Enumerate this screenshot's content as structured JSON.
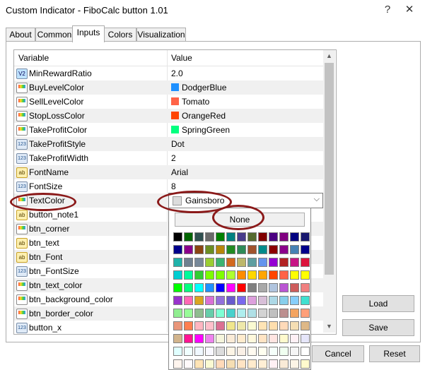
{
  "window": {
    "title": "Custom Indicator - FiboCalc button 1.01",
    "help_glyph": "?",
    "close_glyph": "✕"
  },
  "tabs": [
    {
      "label": "About"
    },
    {
      "label": "Common"
    },
    {
      "label": "Inputs",
      "active": true
    },
    {
      "label": "Colors"
    },
    {
      "label": "Visualization"
    }
  ],
  "grid": {
    "header": {
      "variable": "Variable",
      "value": "Value"
    },
    "rows": [
      {
        "name": "MinRewardRatio",
        "icon": "v2-icon",
        "value": "2.0"
      },
      {
        "name": "BuyLevelColor",
        "icon": "color-icon",
        "value": "DodgerBlue",
        "color": "#1e90ff"
      },
      {
        "name": "SellLevelColor",
        "icon": "color-icon",
        "value": "Tomato",
        "color": "#ff6347"
      },
      {
        "name": "StopLossColor",
        "icon": "color-icon",
        "value": "OrangeRed",
        "color": "#ff4500"
      },
      {
        "name": "TakeProfitColor",
        "icon": "color-icon",
        "value": "SpringGreen",
        "color": "#00ff7f"
      },
      {
        "name": "TakeProfitStyle",
        "icon": "int-icon",
        "value": "Dot"
      },
      {
        "name": "TakeProfitWidth",
        "icon": "int-icon",
        "value": "2"
      },
      {
        "name": "FontName",
        "icon": "string-icon",
        "value": "Arial"
      },
      {
        "name": "FontSize",
        "icon": "int-icon",
        "value": "8"
      },
      {
        "name": "TextColor",
        "icon": "color-icon",
        "value": ""
      },
      {
        "name": "button_note1",
        "icon": "string-icon",
        "value": ""
      },
      {
        "name": "btn_corner",
        "icon": "color-icon",
        "value": ""
      },
      {
        "name": "btn_text",
        "icon": "string-icon",
        "value": ""
      },
      {
        "name": "btn_Font",
        "icon": "string-icon",
        "value": ""
      },
      {
        "name": "btn_FontSize",
        "icon": "int-icon",
        "value": ""
      },
      {
        "name": "btn_text_color",
        "icon": "color-icon",
        "value": ""
      },
      {
        "name": "btn_background_color",
        "icon": "color-icon",
        "value": ""
      },
      {
        "name": "btn_border_color",
        "icon": "color-icon",
        "value": ""
      },
      {
        "name": "button_x",
        "icon": "int-icon",
        "value": ""
      }
    ]
  },
  "dropdown": {
    "value": "Gainsboro",
    "swatch": "#dcdcdc"
  },
  "popup": {
    "none_label": "None"
  },
  "palette": [
    [
      "#000000",
      "#006400",
      "#2f4f4f",
      "#696969",
      "#008000",
      "#008080",
      "#483d8b",
      "#556b2f",
      "#800000",
      "#4b0082",
      "#800080",
      "#000080",
      "#191970"
    ],
    [
      "#00008b",
      "#8b008b",
      "#8b4513",
      "#6b8e23",
      "#b8860b",
      "#228b22",
      "#2e8b57",
      "#a0522d",
      "#008b8b",
      "#8b0000",
      "#8b008b",
      "#4682b4",
      "#00008b"
    ],
    [
      "#20b2aa",
      "#708090",
      "#778899",
      "#9acd32",
      "#3cb371",
      "#d2691e",
      "#bdb76b",
      "#5f9ea0",
      "#6495ed",
      "#9400d3",
      "#b22222",
      "#c71585",
      "#dc143c"
    ],
    [
      "#00ced1",
      "#00fa9a",
      "#32cd32",
      "#7cfc00",
      "#7fff00",
      "#adff2f",
      "#ff8c00",
      "#ffd700",
      "#ffa500",
      "#ff4500",
      "#ff6347",
      "#ffff00",
      "#ffff00"
    ],
    [
      "#00ff00",
      "#00ff7f",
      "#00ffff",
      "#1e90ff",
      "#0000ff",
      "#ff00ff",
      "#ff0000",
      "#808080",
      "#a9a9a9",
      "#b0c4de",
      "#ba55d3",
      "#cd5c5c",
      "#f08080"
    ],
    [
      "#9932cc",
      "#ff69b4",
      "#daa520",
      "#da70d6",
      "#9370db",
      "#6a5acd",
      "#7b68ee",
      "#dda0dd",
      "#d8bfd8",
      "#add8e6",
      "#87ceeb",
      "#87cefa",
      "#40e0d0"
    ],
    [
      "#90ee90",
      "#98fb98",
      "#8fbc8f",
      "#66cdaa",
      "#7fffd4",
      "#48d1cc",
      "#afeeee",
      "#b0e0e6",
      "#d3d3d3",
      "#c0c0c0",
      "#bc8f8f",
      "#f4a460",
      "#ffa07a"
    ],
    [
      "#e9967a",
      "#ff7f50",
      "#ffb6c1",
      "#ffc0cb",
      "#db7093",
      "#f0e68c",
      "#eee8aa",
      "#fafad2",
      "#ffe4b5",
      "#ffdead",
      "#ffdab9",
      "#f5deb3",
      "#deb887"
    ],
    [
      "#d2b48c",
      "#ff1493",
      "#ff00ff",
      "#ee82ee",
      "#f5f5dc",
      "#faebd7",
      "#ffebcd",
      "#fff8dc",
      "#ffe4c4",
      "#ffe4e1",
      "#fffacd",
      "#fff0f5",
      "#e6e6fa"
    ],
    [
      "#e0ffff",
      "#f0ffff",
      "#f0f8ff",
      "#f8f8ff",
      "#dcdcdc",
      "#fdf5e6",
      "#faf0e6",
      "#fffaf0",
      "#fffff0",
      "#f5fffa",
      "#f0fff0",
      "#f5f5f5",
      "#ffffff"
    ],
    [
      "#fff5ee",
      "#fffafa",
      "#ffe4b5",
      "#fafad2",
      "#ffdab9",
      "#f5deb3",
      "#ffe4c4",
      "#ffebcd",
      "#ffefd5",
      "#fff0f5",
      "#faebd7",
      "#fdf5e6",
      "#fffacd"
    ]
  ],
  "buttons": {
    "load": "Load",
    "save": "Save",
    "cancel": "Cancel",
    "reset": "Reset"
  }
}
